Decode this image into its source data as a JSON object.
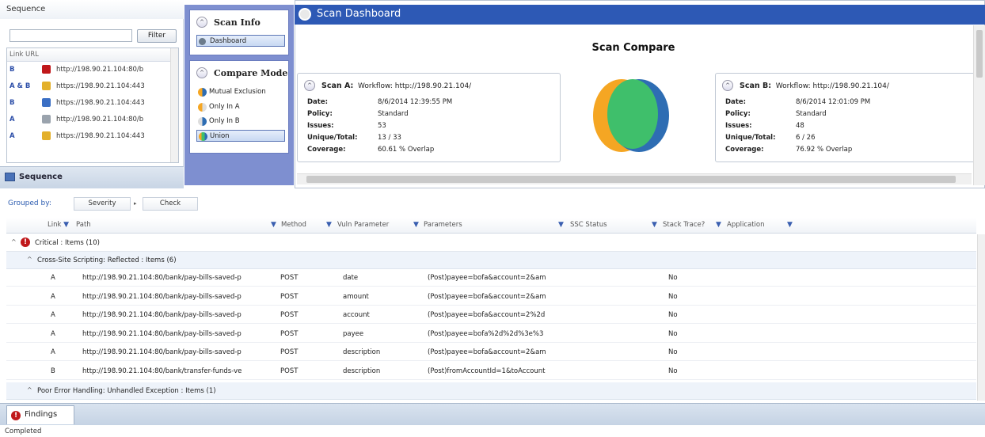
{
  "sequence": {
    "header": "Sequence",
    "filter_label": "Filter",
    "col_link": "Link",
    "col_url": "URL",
    "rows": [
      {
        "link": "B",
        "url": "http://198.90.21.104:80/b",
        "icon": "error-page-icon",
        "color": "#c0181b"
      },
      {
        "link": "A & B",
        "url": "https://198.90.21.104:443",
        "icon": "folder-page-icon",
        "color": "#e3b02b"
      },
      {
        "link": "B",
        "url": "https://198.90.21.104:443",
        "icon": "page-icon",
        "color": "#3b6fc4"
      },
      {
        "link": "A",
        "url": "http://198.90.21.104:80/b",
        "icon": "page-icon",
        "color": "#9aa3ad"
      },
      {
        "link": "A",
        "url": "https://198.90.21.104:443",
        "icon": "folder-page-icon",
        "color": "#e3b02b"
      }
    ],
    "footer_label": "Sequence"
  },
  "nav": {
    "scan_info_title": "Scan Info",
    "dashboard_label": "Dashboard",
    "compare_mode_title": "Compare Mode",
    "modes": [
      "Mutual Exclusion",
      "Only In A",
      "Only In B",
      "Union"
    ],
    "selected_mode": "Union"
  },
  "dashboard": {
    "title": "Scan Dashboard",
    "compare_title": "Scan Compare",
    "scan_a": {
      "name": "Scan A:",
      "workflow": "Workflow: http://198.90.21.104/",
      "date_label": "Date:",
      "date": "8/6/2014 12:39:55 PM",
      "policy_label": "Policy:",
      "policy": "Standard",
      "issues_label": "Issues:",
      "issues": "53",
      "unique_label": "Unique/Total:",
      "unique": "13 / 33",
      "coverage_label": "Coverage:",
      "coverage": "60.61 % Overlap"
    },
    "scan_b": {
      "name": "Scan B:",
      "workflow": "Workflow: http://198.90.21.104/",
      "date_label": "Date:",
      "date": "8/6/2014 12:01:09 PM",
      "policy_label": "Policy:",
      "policy": "Standard",
      "issues_label": "Issues:",
      "issues": "48",
      "unique_label": "Unique/Total:",
      "unique": "6 / 26",
      "coverage_label": "Coverage:",
      "coverage": "76.92 % Overlap"
    },
    "venn_colors": {
      "a": "#f5a623",
      "b": "#2e6db3",
      "overlap": "#3fbf6b"
    }
  },
  "grid": {
    "grouped_by_label": "Grouped by:",
    "group_chips": [
      "Severity",
      "Check"
    ],
    "columns": [
      "Link",
      "Path",
      "Method",
      "Vuln Parameter",
      "Parameters",
      "SSC Status",
      "Stack Trace?",
      "Application"
    ],
    "group_critical": "Critical   : Items (10)",
    "subgroup_xss": "Cross-Site Scripting: Reflected    : Items (6)",
    "rows": [
      {
        "link": "A",
        "path": "http://198.90.21.104:80/bank/pay-bills-saved-p",
        "method": "POST",
        "vuln": "date",
        "params": "(Post)payee=bofa&account=2&am",
        "stack": "No"
      },
      {
        "link": "A",
        "path": "http://198.90.21.104:80/bank/pay-bills-saved-p",
        "method": "POST",
        "vuln": "amount",
        "params": "(Post)payee=bofa&account=2&am",
        "stack": "No"
      },
      {
        "link": "A",
        "path": "http://198.90.21.104:80/bank/pay-bills-saved-p",
        "method": "POST",
        "vuln": "account",
        "params": "(Post)payee=bofa&account=2%2d",
        "stack": "No"
      },
      {
        "link": "A",
        "path": "http://198.90.21.104:80/bank/pay-bills-saved-p",
        "method": "POST",
        "vuln": "payee",
        "params": "(Post)payee=bofa%2d%2d%3e%3",
        "stack": "No"
      },
      {
        "link": "A",
        "path": "http://198.90.21.104:80/bank/pay-bills-saved-p",
        "method": "POST",
        "vuln": "description",
        "params": "(Post)payee=bofa&account=2&am",
        "stack": "No"
      },
      {
        "link": "B",
        "path": "http://198.90.21.104:80/bank/transfer-funds-ve",
        "method": "POST",
        "vuln": "description",
        "params": "(Post)fromAccountId=1&toAccount",
        "stack": "No"
      }
    ],
    "subgroup_error": "Poor Error Handling: Unhandled Exception    : Items (1)"
  },
  "findings_tab": "Findings",
  "status_text": "Completed"
}
